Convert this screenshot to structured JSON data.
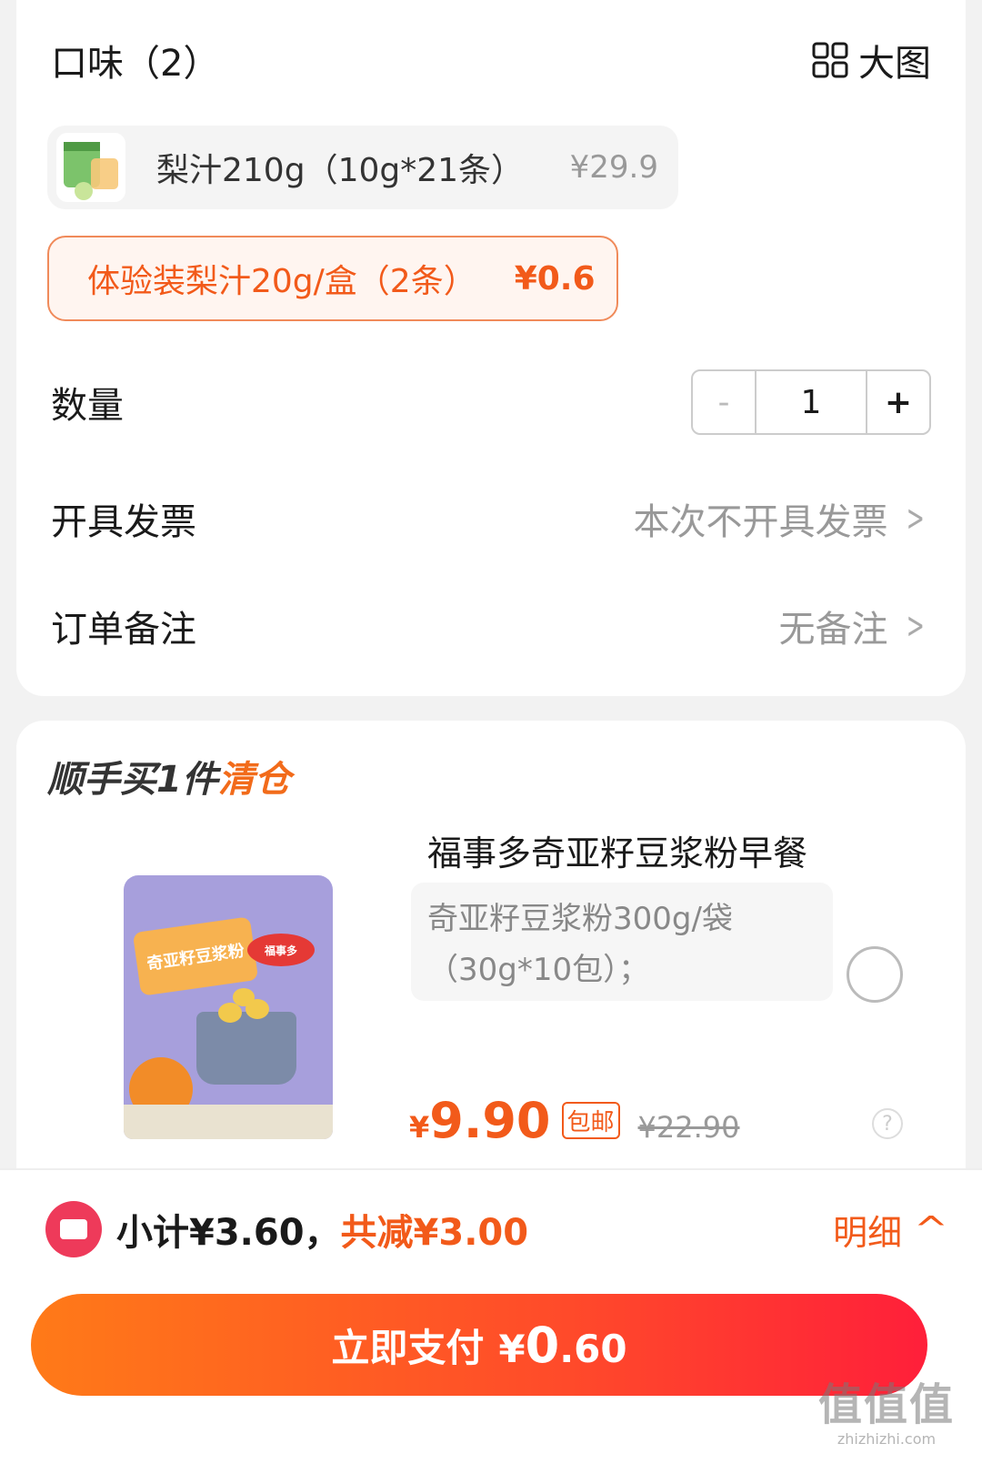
{
  "flavor": {
    "title": "口味（2）",
    "big_view_label": "大图",
    "options": [
      {
        "label": "梨汁210g（10g*21条）",
        "price": "¥29.9",
        "selected": false
      },
      {
        "label": "体验装梨汁20g/盒（2条）",
        "price": "¥0.6",
        "selected": true
      }
    ]
  },
  "quantity": {
    "label": "数量",
    "minus": "-",
    "value": "1",
    "plus": "+"
  },
  "invoice": {
    "label": "开具发票",
    "value": "本次不开具发票"
  },
  "remark": {
    "label": "订单备注",
    "value": "无备注"
  },
  "upsell": {
    "title_prefix": "顺手买1件",
    "title_accent": "清仓",
    "product": {
      "name": "福事多奇亚籽豆浆粉早餐",
      "spec_line1": "奇亚籽豆浆粉300g/袋",
      "spec_line2": "（30g*10包）；",
      "price_symbol": "¥",
      "price": "9.90",
      "shipping_badge": "包邮",
      "original_price": "¥22.90",
      "help": "?",
      "image_texts": {
        "label": "奇亚籽豆浆粉",
        "brand": "福事多"
      }
    }
  },
  "summary": {
    "subtotal": "小计¥3.60，",
    "reduced": "共减¥3.00",
    "detail_label": "明细",
    "caret": "^"
  },
  "pay": {
    "label": "立即支付",
    "symbol": "¥",
    "amount_int": "0",
    "amount_dec": ".60"
  },
  "watermark": {
    "main": "值值值",
    "sub": "zhizhizhi.com"
  },
  "colors": {
    "accent": "#f25a1a",
    "pay_start": "#ff7a18",
    "pay_end": "#ff1f3a"
  }
}
